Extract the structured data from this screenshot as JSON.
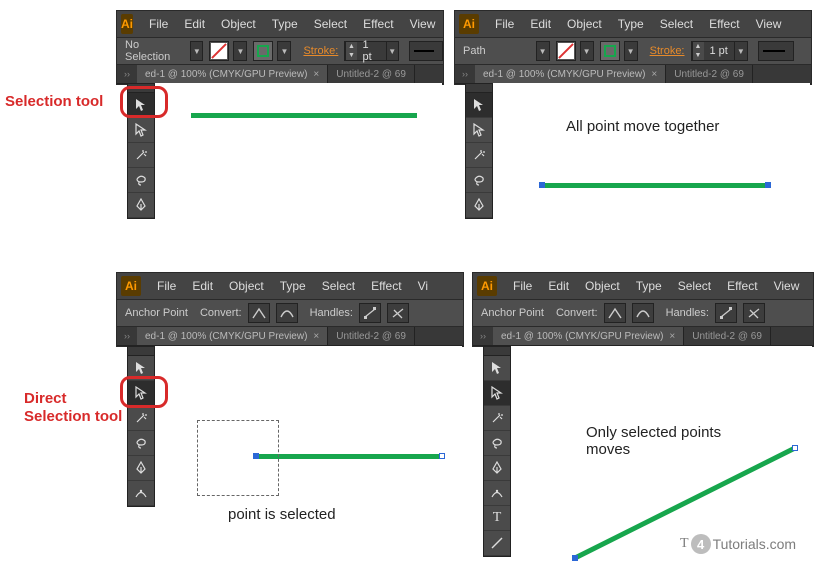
{
  "labels": {
    "selection_tool": "Selection tool",
    "direct_selection_tool_l1": "Direct",
    "direct_selection_tool_l2": "Selection tool"
  },
  "captions": {
    "all_points": "All point move together",
    "point_selected": "point is selected",
    "only_selected_l1": "Only selected points",
    "only_selected_l2": "moves"
  },
  "menu": {
    "ai": "Ai",
    "items": [
      "File",
      "Edit",
      "Object",
      "Type",
      "Select",
      "Effect",
      "View"
    ]
  },
  "ctrl_noselection": {
    "label": "No Selection",
    "stroke_label": "Stroke:",
    "stroke_value": "1 pt"
  },
  "ctrl_path": {
    "label": "Path",
    "stroke_label": "Stroke:",
    "stroke_value": "1 pt"
  },
  "ctrl_anchor": {
    "label": "Anchor Point",
    "convert": "Convert:",
    "handles": "Handles:"
  },
  "tabs": {
    "active": "ed-1 @ 100% (CMYK/GPU Preview)",
    "inactive": "Untitled-2 @ 69"
  },
  "watermark": {
    "t": "T",
    "four": "4",
    "rest": "Tutorials.com"
  }
}
